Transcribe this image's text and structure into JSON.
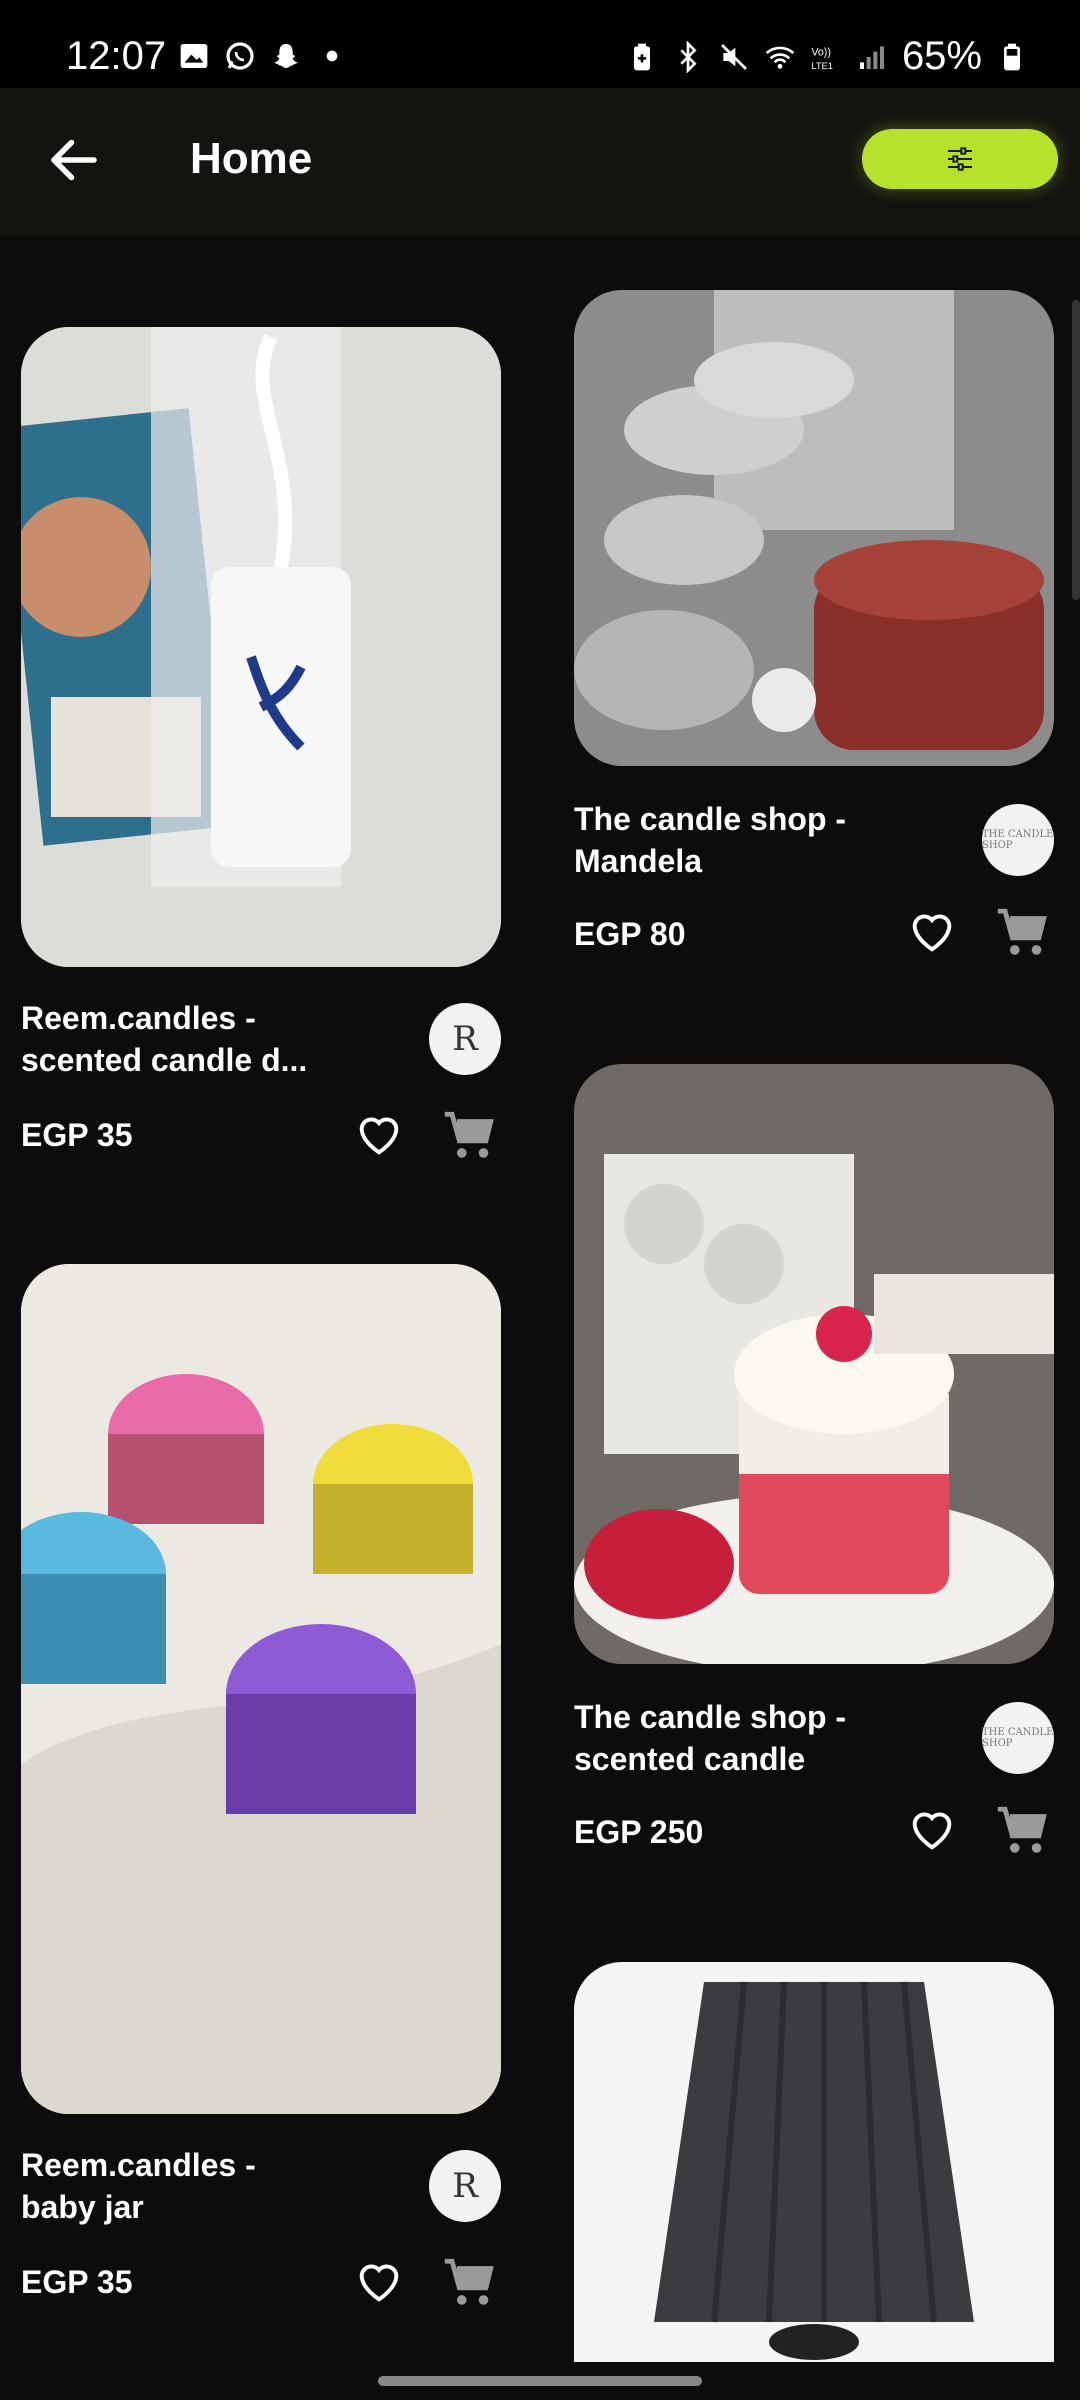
{
  "status_bar": {
    "time": "12:07",
    "battery": "65%",
    "icons": [
      "gallery-icon",
      "whatsapp-icon",
      "snapchat-icon",
      "dot-icon",
      "battery-saver-icon",
      "bluetooth-icon",
      "mute-icon",
      "wifi-icon",
      "volte-icon",
      "signal-icon",
      "battery-icon"
    ]
  },
  "app_bar": {
    "title": "Home",
    "back_icon": "arrow-left-icon",
    "filter_icon": "sliders-icon",
    "accent_color": "#b6e22b"
  },
  "products": [
    {
      "name": "Reem.candles -\nscented candle d...",
      "price": "EGP 35",
      "logo": "R",
      "image": "lavender-scent-wax-sachet"
    },
    {
      "name": "The candle shop -\nMandela",
      "price": "EGP 80",
      "logo": "THE CANDLE SHOP",
      "image": "tin-candle-with-tulips"
    },
    {
      "name": "Reem.candles -\nbaby jar",
      "price": "EGP 35",
      "logo": "R",
      "image": "colored-baby-jar-candles"
    },
    {
      "name": "The candle shop -\nscented candle",
      "price": "EGP 250",
      "logo": "THE CANDLE SHOP",
      "image": "whipped-cream-red-candle"
    },
    {
      "name": "",
      "price": "",
      "logo": "",
      "image": "black-pleated-lampshade"
    }
  ]
}
